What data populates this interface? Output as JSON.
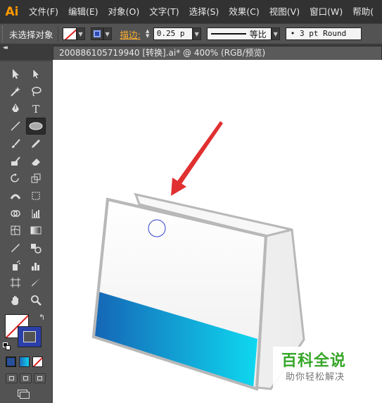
{
  "app": {
    "logo": "Ai"
  },
  "menu": [
    "文件(F)",
    "编辑(E)",
    "对象(O)",
    "文字(T)",
    "选择(S)",
    "效果(C)",
    "视图(V)",
    "窗口(W)",
    "帮助("
  ],
  "control_bar": {
    "selection_status": "未选择对象",
    "stroke_label": "描边:",
    "stroke_weight": "0.25 p",
    "variable_width_label": "等比",
    "brush_definition": "• 3 pt Round"
  },
  "document": {
    "tab_title": "200886105719940  [转换].ai* @ 400% (RGB/预览)"
  },
  "tools": [
    "selection-tool",
    "direct-selection-tool",
    "magic-wand-tool",
    "lasso-tool",
    "pen-tool",
    "type-tool",
    "line-segment-tool",
    "ellipse-tool",
    "paintbrush-tool",
    "pencil-tool",
    "blob-brush-tool",
    "eraser-tool",
    "rotate-tool",
    "scale-tool",
    "width-tool",
    "free-transform-tool",
    "shape-builder-tool",
    "graph-tool",
    "mesh-tool",
    "gradient-tool",
    "eyedropper-tool",
    "blend-tool",
    "symbol-sprayer-tool",
    "column-graph-tool",
    "artboard-tool",
    "slice-tool",
    "hand-tool",
    "zoom-tool"
  ],
  "colors": {
    "accent_orange": "#ff9a00",
    "arrow_red": "#e03030",
    "gradient_start": "#1565b5",
    "gradient_end": "#0fd8f0",
    "stroke_blue": "#2b3fa8",
    "watermark_green": "#37a629"
  },
  "watermark": {
    "title": "百科全说",
    "subtitle": "助你轻松解决"
  }
}
